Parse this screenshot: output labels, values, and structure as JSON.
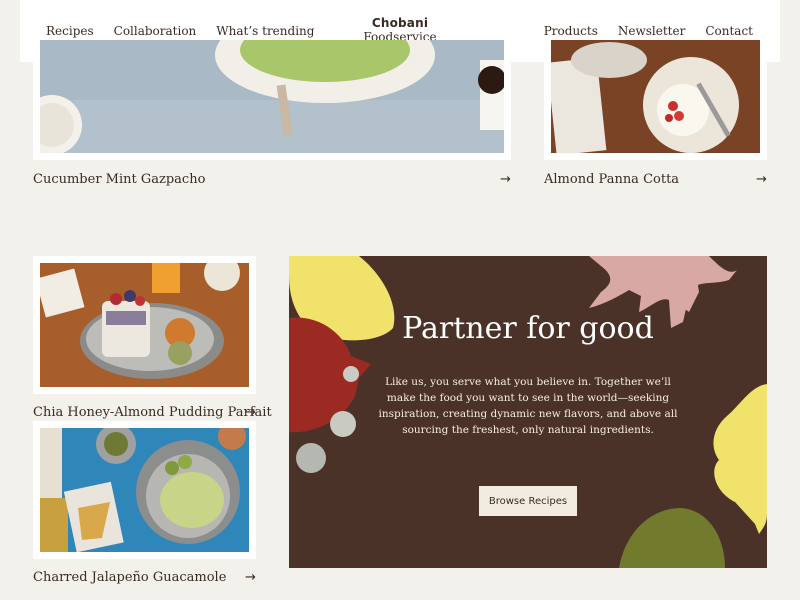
{
  "header": {
    "nav_left": [
      "Recipes",
      "Collaboration",
      "What’s trending"
    ],
    "nav_right": [
      "Products",
      "Newsletter",
      "Contact"
    ],
    "logo_top": "Chobani",
    "logo_bottom": "Foodservice"
  },
  "recipes": [
    {
      "name": "Cucumber Mint Gazpacho",
      "arrow": "→"
    },
    {
      "name": "Almond Panna Cotta",
      "arrow": "→"
    },
    {
      "name": "Chia Honey-Almond Pudding Parfait",
      "arrow": "→"
    },
    {
      "name": "Charred Jalapeño Guacamole",
      "arrow": "→"
    }
  ],
  "partner": {
    "title": "Partner for good",
    "body": "Like us, you serve what you believe in. Together we’ll make the food you want to see in the world—seeking inspiration, creating dynamic new flavors, and above all sourcing the freshest, only natural ingredients.",
    "button": "Browse Recipes"
  },
  "colors": {
    "page_bg": "#f3f1ec",
    "panel_bg": "#4b3228",
    "button_bg": "#f2ece0",
    "text": "#3a2a22"
  }
}
